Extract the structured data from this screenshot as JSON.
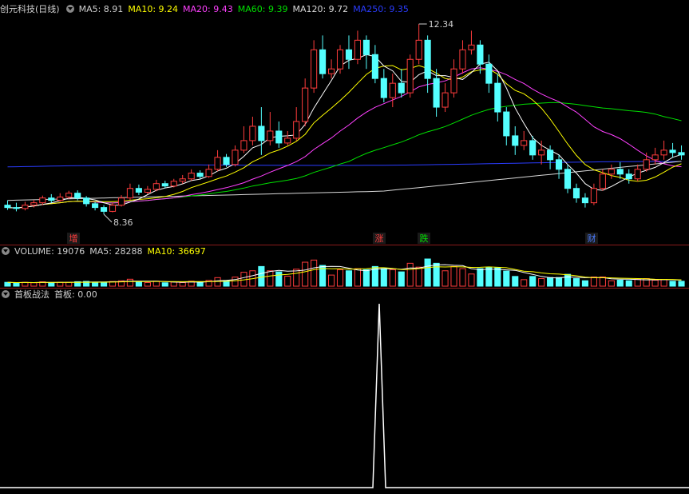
{
  "colors": {
    "up": "#ff3c3c",
    "down": "#54ffff",
    "ma5": "#ffffff",
    "ma10": "#ffff00",
    "ma20": "#ff40ff",
    "ma60": "#00e000",
    "ma120": "#d8d8d8",
    "ma250": "#2a3cff",
    "axis": "#8a1a1a",
    "indicator": "#ffffff"
  },
  "price_panel": {
    "title": "创元科技(日线)",
    "ma5": "MA5: 8.91",
    "ma10": "MA10: 9.24",
    "ma20": "MA20: 9.43",
    "ma60": "MA60: 9.39",
    "ma120": "MA120: 9.72",
    "ma250": "MA250: 9.35",
    "high_label": "12.34",
    "low_label": "8.36",
    "markers": [
      {
        "text": "增",
        "color": "#ff3c3c"
      },
      {
        "text": "涨",
        "color": "#ff3c3c"
      },
      {
        "text": "跌",
        "color": "#00e000"
      },
      {
        "text": "财",
        "color": "#4a7cff"
      }
    ]
  },
  "volume_panel": {
    "title": "VOLUME: 19076",
    "ma5": "MA5: 28288",
    "ma10": "MA10: 36697"
  },
  "indicator_panel": {
    "title": "首板战法",
    "value": "首板: 0.00"
  },
  "chart_data": {
    "type": "candlestick",
    "note_series": "daily OHLC, ~78 bars",
    "high": 12.34,
    "low": 8.36,
    "candles": [
      [
        8.55,
        8.5,
        8.65,
        8.45
      ],
      [
        8.5,
        8.48,
        8.6,
        8.42
      ],
      [
        8.48,
        8.55,
        8.62,
        8.44
      ],
      [
        8.55,
        8.6,
        8.66,
        8.5
      ],
      [
        8.6,
        8.7,
        8.75,
        8.55
      ],
      [
        8.7,
        8.65,
        8.78,
        8.6
      ],
      [
        8.65,
        8.72,
        8.8,
        8.62
      ],
      [
        8.72,
        8.8,
        8.85,
        8.68
      ],
      [
        8.8,
        8.7,
        8.86,
        8.65
      ],
      [
        8.7,
        8.58,
        8.74,
        8.52
      ],
      [
        8.58,
        8.5,
        8.62,
        8.44
      ],
      [
        8.5,
        8.42,
        8.55,
        8.36
      ],
      [
        8.42,
        8.55,
        8.6,
        8.4
      ],
      [
        8.55,
        8.7,
        8.76,
        8.52
      ],
      [
        8.7,
        8.9,
        9.0,
        8.66
      ],
      [
        8.9,
        8.82,
        8.98,
        8.76
      ],
      [
        8.82,
        8.88,
        8.95,
        8.78
      ],
      [
        8.88,
        9.0,
        9.08,
        8.84
      ],
      [
        9.0,
        8.95,
        9.06,
        8.9
      ],
      [
        8.95,
        9.05,
        9.1,
        8.92
      ],
      [
        9.05,
        9.1,
        9.18,
        9.0
      ],
      [
        9.1,
        9.22,
        9.3,
        9.06
      ],
      [
        9.22,
        9.15,
        9.28,
        9.1
      ],
      [
        9.15,
        9.3,
        9.4,
        9.12
      ],
      [
        9.3,
        9.55,
        9.7,
        9.26
      ],
      [
        9.55,
        9.4,
        9.62,
        9.35
      ],
      [
        9.4,
        9.7,
        9.8,
        9.36
      ],
      [
        9.7,
        9.9,
        10.2,
        9.64
      ],
      [
        9.9,
        10.2,
        10.4,
        9.8
      ],
      [
        10.2,
        9.9,
        10.6,
        9.6
      ],
      [
        9.9,
        10.1,
        10.5,
        9.8
      ],
      [
        10.1,
        9.85,
        10.3,
        9.75
      ],
      [
        9.85,
        9.95,
        10.1,
        9.8
      ],
      [
        9.95,
        10.3,
        10.6,
        9.9
      ],
      [
        10.3,
        11.0,
        11.2,
        10.2
      ],
      [
        11.0,
        11.8,
        12.0,
        10.9
      ],
      [
        11.8,
        11.3,
        12.1,
        11.2
      ],
      [
        11.3,
        11.4,
        11.6,
        11.2
      ],
      [
        11.4,
        11.8,
        11.9,
        11.3
      ],
      [
        11.8,
        11.6,
        12.1,
        11.4
      ],
      [
        11.6,
        12.0,
        12.2,
        11.5
      ],
      [
        12.0,
        11.7,
        12.1,
        11.4
      ],
      [
        11.7,
        11.2,
        11.9,
        11.1
      ],
      [
        11.2,
        10.8,
        11.4,
        10.7
      ],
      [
        10.8,
        11.1,
        11.3,
        10.6
      ],
      [
        11.1,
        10.9,
        11.4,
        10.8
      ],
      [
        10.9,
        11.6,
        11.7,
        10.8
      ],
      [
        11.6,
        12.0,
        12.34,
        11.5
      ],
      [
        12.0,
        11.2,
        12.1,
        10.9
      ],
      [
        11.2,
        10.6,
        11.4,
        10.4
      ],
      [
        10.6,
        10.9,
        11.1,
        10.5
      ],
      [
        10.9,
        11.4,
        11.6,
        10.8
      ],
      [
        11.4,
        11.8,
        12.0,
        11.3
      ],
      [
        11.8,
        11.9,
        12.2,
        11.7
      ],
      [
        11.9,
        11.5,
        12.0,
        11.3
      ],
      [
        11.5,
        11.1,
        11.7,
        10.9
      ],
      [
        11.1,
        10.5,
        11.3,
        10.3
      ],
      [
        10.5,
        10.0,
        10.6,
        9.8
      ],
      [
        10.0,
        9.8,
        10.2,
        9.6
      ],
      [
        9.8,
        9.9,
        10.1,
        9.7
      ],
      [
        9.9,
        9.6,
        10.0,
        9.5
      ],
      [
        9.6,
        9.7,
        9.9,
        9.4
      ],
      [
        9.7,
        9.5,
        9.8,
        9.3
      ],
      [
        9.5,
        9.3,
        9.6,
        9.1
      ],
      [
        9.3,
        8.9,
        9.4,
        8.8
      ],
      [
        8.9,
        8.7,
        9.0,
        8.6
      ],
      [
        8.7,
        8.6,
        8.8,
        8.5
      ],
      [
        8.6,
        8.9,
        9.0,
        8.55
      ],
      [
        8.9,
        9.2,
        9.3,
        8.85
      ],
      [
        9.2,
        9.3,
        9.4,
        9.1
      ],
      [
        9.3,
        9.2,
        9.45,
        9.1
      ],
      [
        9.2,
        9.1,
        9.3,
        9.0
      ],
      [
        9.1,
        9.3,
        9.4,
        9.05
      ],
      [
        9.3,
        9.5,
        9.65,
        9.25
      ],
      [
        9.5,
        9.6,
        9.75,
        9.4
      ],
      [
        9.6,
        9.7,
        9.9,
        9.5
      ],
      [
        9.7,
        9.65,
        9.85,
        9.55
      ],
      [
        9.65,
        9.6,
        9.8,
        9.5
      ]
    ]
  }
}
